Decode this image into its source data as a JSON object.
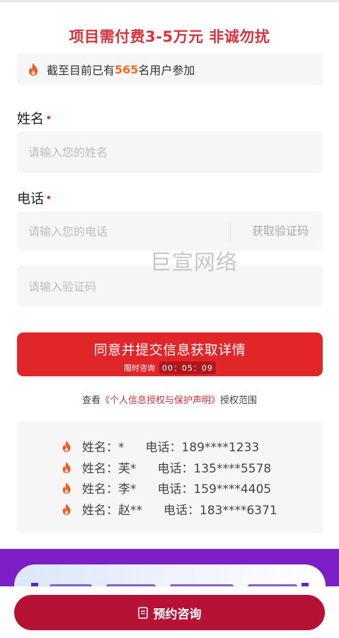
{
  "headline": "项目需付费3-5万元 非诚勿扰",
  "participants": {
    "prefix": "截至目前已有",
    "count": "565",
    "suffix": "名用户参加"
  },
  "form": {
    "name_label": "姓名",
    "name_placeholder": "请输入您的姓名",
    "phone_label": "电话",
    "phone_placeholder": "请输入您的电话",
    "get_code": "获取验证码",
    "code_placeholder": "请输入验证码",
    "required_mark": "•"
  },
  "watermark": "巨宣网络",
  "submit": {
    "label": "同意并提交信息获取详情",
    "timer_label": "限时咨询",
    "timer": "00：05：09"
  },
  "privacy": {
    "prefix": "查看",
    "link": "《个人信息授权与保护声明》",
    "suffix": "授权范围"
  },
  "records": [
    {
      "name": "姓名：*",
      "phone": "电话：189****1233"
    },
    {
      "name": "姓名：芙*",
      "phone": "电话：135****5578"
    },
    {
      "name": "姓名：李*",
      "phone": "电话：159****4405"
    },
    {
      "name": "姓名：赵**",
      "phone": "电话：183****6371"
    }
  ],
  "bottom": {
    "book_label": "预约咨询"
  },
  "colors": {
    "primary_red": "#e1262a",
    "headline_red": "#d9323a",
    "count_orange": "#f07021",
    "book_button": "#b51235",
    "banner_purple": "#7c1fc9"
  }
}
